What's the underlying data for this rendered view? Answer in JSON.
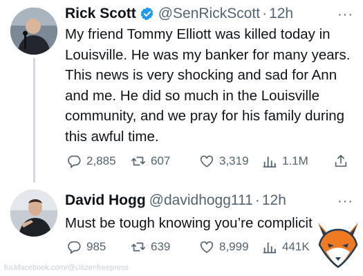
{
  "tweets": [
    {
      "author": {
        "name": "Rick Scott",
        "handle": "@SenRickScott",
        "verified": true,
        "avatar_icon": "person-at-microphone-avatar"
      },
      "time": "12h",
      "separator": "·",
      "more": "···",
      "text": "My friend Tommy Elliott was killed today in Louisville. He was my banker for many years. This news is very shocking and sad for Ann and me. He did so much in the Louisville community, and we pray for his family during this awful time.",
      "stats": {
        "replies": "2,885",
        "reposts": "607",
        "likes": "3,319",
        "views": "1.1M"
      }
    },
    {
      "author": {
        "name": "David Hogg",
        "handle": "@davidhogg111",
        "verified": false,
        "avatar_icon": "person-speaking-avatar"
      },
      "time": "12h",
      "separator": "·",
      "more": "···",
      "text": "Must be tough knowing you’re complicit",
      "stats": {
        "replies": "985",
        "reposts": "639",
        "likes": "8,999",
        "views": "441K"
      }
    }
  ],
  "watermark": "fuckfacebook.com/@citizenfreepress",
  "colors": {
    "text": "#0f1419",
    "secondary": "#536471",
    "verified": "#1d9bf0",
    "thread_line": "#cfd9de"
  },
  "icons": [
    "reply-icon",
    "repost-icon",
    "like-icon",
    "views-icon",
    "share-icon",
    "verified-badge-icon",
    "fox-logo-icon"
  ]
}
